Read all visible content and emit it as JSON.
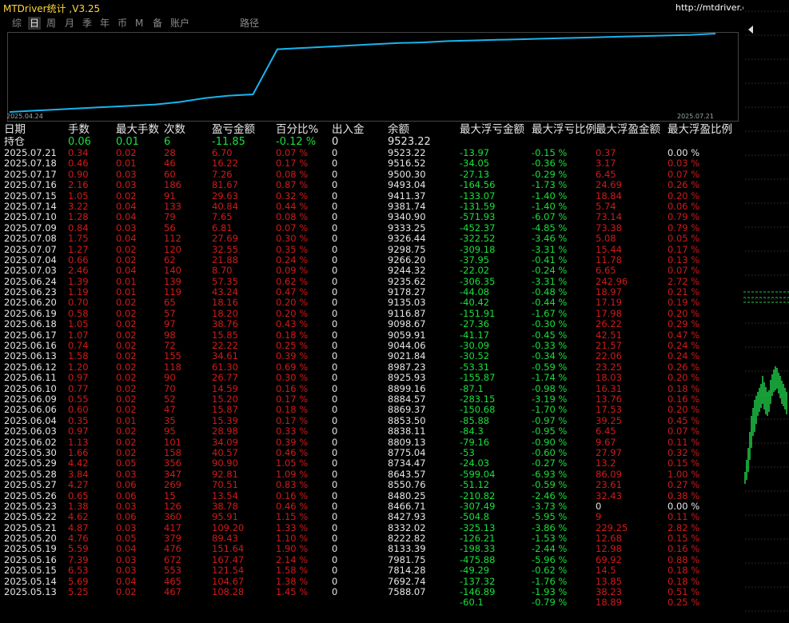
{
  "app": {
    "title": "MTDriver统计 ,V3.25",
    "url": "http://mtdriver.cn"
  },
  "tabs": [
    {
      "label": "综",
      "active": false
    },
    {
      "label": "日",
      "active": true
    },
    {
      "label": "周",
      "active": false
    },
    {
      "label": "月",
      "active": false
    },
    {
      "label": "季",
      "active": false
    },
    {
      "label": "年",
      "active": false
    },
    {
      "label": "币",
      "active": false
    },
    {
      "label": "M",
      "active": false
    },
    {
      "label": "备",
      "active": false
    },
    {
      "label": "账户",
      "active": false
    },
    {
      "label": "路径",
      "active": false
    }
  ],
  "colors": {
    "line": "#19b4ee",
    "positive": "#19e03a",
    "negative": "#d11a1a",
    "border": "#444444"
  },
  "chart_data": {
    "type": "line",
    "x_start_label": "2025.04.24",
    "x_end_label": "2025.07.21",
    "series": [
      {
        "values": [
          0.0,
          0.02,
          0.04,
          0.06,
          0.08,
          0.1,
          0.12,
          0.16,
          0.22,
          0.26,
          0.28,
          1.0,
          1.02,
          1.04,
          1.06,
          1.08,
          1.1,
          1.11,
          1.13,
          1.14,
          1.15,
          1.16,
          1.17,
          1.18,
          1.19,
          1.2,
          1.21,
          1.22,
          1.23,
          1.25
        ]
      }
    ]
  },
  "table": {
    "headers": [
      "日期",
      "手数",
      "最大手数",
      "次数",
      "盈亏金额",
      "百分比%",
      "出入金",
      "余额",
      "最大浮亏金额",
      "最大浮亏比例",
      "最大浮盈金额",
      "最大浮盈比例"
    ],
    "holding": {
      "date": "持仓",
      "lots": "0.06",
      "max_lots": "0.01",
      "count": "6",
      "pnl": "-11.85",
      "pct": "-0.12 %",
      "io": "0",
      "balance": "9523.22",
      "mfl_amt": "",
      "mfl_pct": "",
      "mfp_amt": "",
      "mfp_pct": ""
    },
    "rows": [
      {
        "date": "2025.07.21",
        "lots": "0.34",
        "max_lots": "0.02",
        "count": "28",
        "pnl": "6.70",
        "pct": "0.07 %",
        "io": "0",
        "balance": "9523.22",
        "mfl_amt": "-13.97",
        "mfl_pct": "-0.15 %",
        "mfp_amt": "0.37",
        "mfp_pct": "0.00 %"
      },
      {
        "date": "2025.07.18",
        "lots": "0.46",
        "max_lots": "0.01",
        "count": "46",
        "pnl": "16.22",
        "pct": "0.17 %",
        "io": "0",
        "balance": "9516.52",
        "mfl_amt": "-34.05",
        "mfl_pct": "-0.36 %",
        "mfp_amt": "3.17",
        "mfp_pct": "0.03 %"
      },
      {
        "date": "2025.07.17",
        "lots": "0.90",
        "max_lots": "0.03",
        "count": "60",
        "pnl": "7.26",
        "pct": "0.08 %",
        "io": "0",
        "balance": "9500.30",
        "mfl_amt": "-27.13",
        "mfl_pct": "-0.29 %",
        "mfp_amt": "6.45",
        "mfp_pct": "0.07 %"
      },
      {
        "date": "2025.07.16",
        "lots": "2.16",
        "max_lots": "0.03",
        "count": "186",
        "pnl": "81.67",
        "pct": "0.87 %",
        "io": "0",
        "balance": "9493.04",
        "mfl_amt": "-164.56",
        "mfl_pct": "-1.73 %",
        "mfp_amt": "24.69",
        "mfp_pct": "0.26 %"
      },
      {
        "date": "2025.07.15",
        "lots": "1.05",
        "max_lots": "0.02",
        "count": "91",
        "pnl": "29.63",
        "pct": "0.32 %",
        "io": "0",
        "balance": "9411.37",
        "mfl_amt": "-133.07",
        "mfl_pct": "-1.40 %",
        "mfp_amt": "18.84",
        "mfp_pct": "0.20 %"
      },
      {
        "date": "2025.07.14",
        "lots": "3.22",
        "max_lots": "0.04",
        "count": "133",
        "pnl": "40.84",
        "pct": "0.44 %",
        "io": "0",
        "balance": "9381.74",
        "mfl_amt": "-131.59",
        "mfl_pct": "-1.40 %",
        "mfp_amt": "5.74",
        "mfp_pct": "0.06 %"
      },
      {
        "date": "2025.07.10",
        "lots": "1.28",
        "max_lots": "0.04",
        "count": "79",
        "pnl": "7.65",
        "pct": "0.08 %",
        "io": "0",
        "balance": "9340.90",
        "mfl_amt": "-571.93",
        "mfl_pct": "-6.07 %",
        "mfp_amt": "73.14",
        "mfp_pct": "0.79 %"
      },
      {
        "date": "2025.07.09",
        "lots": "0.84",
        "max_lots": "0.03",
        "count": "56",
        "pnl": "6.81",
        "pct": "0.07 %",
        "io": "0",
        "balance": "9333.25",
        "mfl_amt": "-452.37",
        "mfl_pct": "-4.85 %",
        "mfp_amt": "73.38",
        "mfp_pct": "0.79 %"
      },
      {
        "date": "2025.07.08",
        "lots": "1.75",
        "max_lots": "0.04",
        "count": "112",
        "pnl": "27.69",
        "pct": "0.30 %",
        "io": "0",
        "balance": "9326.44",
        "mfl_amt": "-322.52",
        "mfl_pct": "-3.46 %",
        "mfp_amt": "5.08",
        "mfp_pct": "0.05 %"
      },
      {
        "date": "2025.07.07",
        "lots": "1.27",
        "max_lots": "0.02",
        "count": "120",
        "pnl": "32.55",
        "pct": "0.35 %",
        "io": "0",
        "balance": "9298.75",
        "mfl_amt": "-309.18",
        "mfl_pct": "-3.31 %",
        "mfp_amt": "15.44",
        "mfp_pct": "0.17 %"
      },
      {
        "date": "2025.07.04",
        "lots": "0.66",
        "max_lots": "0.02",
        "count": "62",
        "pnl": "21.88",
        "pct": "0.24 %",
        "io": "0",
        "balance": "9266.20",
        "mfl_amt": "-37.95",
        "mfl_pct": "-0.41 %",
        "mfp_amt": "11.78",
        "mfp_pct": "0.13 %"
      },
      {
        "date": "2025.07.03",
        "lots": "2.46",
        "max_lots": "0.04",
        "count": "140",
        "pnl": "8.70",
        "pct": "0.09 %",
        "io": "0",
        "balance": "9244.32",
        "mfl_amt": "-22.02",
        "mfl_pct": "-0.24 %",
        "mfp_amt": "6.65",
        "mfp_pct": "0.07 %"
      },
      {
        "date": "2025.06.24",
        "lots": "1.39",
        "max_lots": "0.01",
        "count": "139",
        "pnl": "57.35",
        "pct": "0.62 %",
        "io": "0",
        "balance": "9235.62",
        "mfl_amt": "-306.35",
        "mfl_pct": "-3.31 %",
        "mfp_amt": "242.96",
        "mfp_pct": "2.72 %"
      },
      {
        "date": "2025.06.23",
        "lots": "1.19",
        "max_lots": "0.01",
        "count": "119",
        "pnl": "43.24",
        "pct": "0.47 %",
        "io": "0",
        "balance": "9178.27",
        "mfl_amt": "-44.08",
        "mfl_pct": "-0.48 %",
        "mfp_amt": "18.97",
        "mfp_pct": "0.21 %"
      },
      {
        "date": "2025.06.20",
        "lots": "0.70",
        "max_lots": "0.02",
        "count": "65",
        "pnl": "18.16",
        "pct": "0.20 %",
        "io": "0",
        "balance": "9135.03",
        "mfl_amt": "-40.42",
        "mfl_pct": "-0.44 %",
        "mfp_amt": "17.19",
        "mfp_pct": "0.19 %"
      },
      {
        "date": "2025.06.19",
        "lots": "0.58",
        "max_lots": "0.02",
        "count": "57",
        "pnl": "18.20",
        "pct": "0.20 %",
        "io": "0",
        "balance": "9116.87",
        "mfl_amt": "-151.91",
        "mfl_pct": "-1.67 %",
        "mfp_amt": "17.98",
        "mfp_pct": "0.20 %"
      },
      {
        "date": "2025.06.18",
        "lots": "1.05",
        "max_lots": "0.02",
        "count": "97",
        "pnl": "38.76",
        "pct": "0.43 %",
        "io": "0",
        "balance": "9098.67",
        "mfl_amt": "-27.36",
        "mfl_pct": "-0.30 %",
        "mfp_amt": "26.22",
        "mfp_pct": "0.29 %"
      },
      {
        "date": "2025.06.17",
        "lots": "1.07",
        "max_lots": "0.02",
        "count": "98",
        "pnl": "15.85",
        "pct": "0.18 %",
        "io": "0",
        "balance": "9059.91",
        "mfl_amt": "-41.17",
        "mfl_pct": "-0.45 %",
        "mfp_amt": "42.51",
        "mfp_pct": "0.47 %"
      },
      {
        "date": "2025.06.16",
        "lots": "0.74",
        "max_lots": "0.02",
        "count": "72",
        "pnl": "22.22",
        "pct": "0.25 %",
        "io": "0",
        "balance": "9044.06",
        "mfl_amt": "-30.09",
        "mfl_pct": "-0.33 %",
        "mfp_amt": "21.57",
        "mfp_pct": "0.24 %"
      },
      {
        "date": "2025.06.13",
        "lots": "1.58",
        "max_lots": "0.02",
        "count": "155",
        "pnl": "34.61",
        "pct": "0.39 %",
        "io": "0",
        "balance": "9021.84",
        "mfl_amt": "-30.52",
        "mfl_pct": "-0.34 %",
        "mfp_amt": "22.06",
        "mfp_pct": "0.24 %"
      },
      {
        "date": "2025.06.12",
        "lots": "1.20",
        "max_lots": "0.02",
        "count": "118",
        "pnl": "61.30",
        "pct": "0.69 %",
        "io": "0",
        "balance": "8987.23",
        "mfl_amt": "-53.31",
        "mfl_pct": "-0.59 %",
        "mfp_amt": "23.25",
        "mfp_pct": "0.26 %"
      },
      {
        "date": "2025.06.11",
        "lots": "0.97",
        "max_lots": "0.02",
        "count": "90",
        "pnl": "26.77",
        "pct": "0.30 %",
        "io": "0",
        "balance": "8925.93",
        "mfl_amt": "-155.87",
        "mfl_pct": "-1.74 %",
        "mfp_amt": "18.03",
        "mfp_pct": "0.20 %"
      },
      {
        "date": "2025.06.10",
        "lots": "0.77",
        "max_lots": "0.02",
        "count": "70",
        "pnl": "14.59",
        "pct": "0.16 %",
        "io": "0",
        "balance": "8899.16",
        "mfl_amt": "-87.1",
        "mfl_pct": "-0.98 %",
        "mfp_amt": "16.31",
        "mfp_pct": "0.18 %"
      },
      {
        "date": "2025.06.09",
        "lots": "0.55",
        "max_lots": "0.02",
        "count": "52",
        "pnl": "15.20",
        "pct": "0.17 %",
        "io": "0",
        "balance": "8884.57",
        "mfl_amt": "-283.15",
        "mfl_pct": "-3.19 %",
        "mfp_amt": "13.76",
        "mfp_pct": "0.16 %"
      },
      {
        "date": "2025.06.06",
        "lots": "0.60",
        "max_lots": "0.02",
        "count": "47",
        "pnl": "15.87",
        "pct": "0.18 %",
        "io": "0",
        "balance": "8869.37",
        "mfl_amt": "-150.68",
        "mfl_pct": "-1.70 %",
        "mfp_amt": "17.53",
        "mfp_pct": "0.20 %"
      },
      {
        "date": "2025.06.04",
        "lots": "0.35",
        "max_lots": "0.01",
        "count": "35",
        "pnl": "15.39",
        "pct": "0.17 %",
        "io": "0",
        "balance": "8853.50",
        "mfl_amt": "-85.88",
        "mfl_pct": "-0.97 %",
        "mfp_amt": "39.25",
        "mfp_pct": "0.45 %"
      },
      {
        "date": "2025.06.03",
        "lots": "0.97",
        "max_lots": "0.02",
        "count": "95",
        "pnl": "28.98",
        "pct": "0.33 %",
        "io": "0",
        "balance": "8838.11",
        "mfl_amt": "-84.3",
        "mfl_pct": "-0.95 %",
        "mfp_amt": "6.45",
        "mfp_pct": "0.07 %"
      },
      {
        "date": "2025.06.02",
        "lots": "1.13",
        "max_lots": "0.02",
        "count": "101",
        "pnl": "34.09",
        "pct": "0.39 %",
        "io": "0",
        "balance": "8809.13",
        "mfl_amt": "-79.16",
        "mfl_pct": "-0.90 %",
        "mfp_amt": "9.67",
        "mfp_pct": "0.11 %"
      },
      {
        "date": "2025.05.30",
        "lots": "1.66",
        "max_lots": "0.02",
        "count": "158",
        "pnl": "40.57",
        "pct": "0.46 %",
        "io": "0",
        "balance": "8775.04",
        "mfl_amt": "-53",
        "mfl_pct": "-0.60 %",
        "mfp_amt": "27.97",
        "mfp_pct": "0.32 %"
      },
      {
        "date": "2025.05.29",
        "lots": "4.42",
        "max_lots": "0.05",
        "count": "356",
        "pnl": "90.90",
        "pct": "1.05 %",
        "io": "0",
        "balance": "8734.47",
        "mfl_amt": "-24.03",
        "mfl_pct": "-0.27 %",
        "mfp_amt": "13.2",
        "mfp_pct": "0.15 %"
      },
      {
        "date": "2025.05.28",
        "lots": "3.84",
        "max_lots": "0.03",
        "count": "347",
        "pnl": "92.81",
        "pct": "1.09 %",
        "io": "0",
        "balance": "8643.57",
        "mfl_amt": "-599.04",
        "mfl_pct": "-6.93 %",
        "mfp_amt": "86.09",
        "mfp_pct": "1.00 %"
      },
      {
        "date": "2025.05.27",
        "lots": "4.27",
        "max_lots": "0.06",
        "count": "269",
        "pnl": "70.51",
        "pct": "0.83 %",
        "io": "0",
        "balance": "8550.76",
        "mfl_amt": "-51.12",
        "mfl_pct": "-0.59 %",
        "mfp_amt": "23.61",
        "mfp_pct": "0.27 %"
      },
      {
        "date": "2025.05.26",
        "lots": "0.65",
        "max_lots": "0.06",
        "count": "15",
        "pnl": "13.54",
        "pct": "0.16 %",
        "io": "0",
        "balance": "8480.25",
        "mfl_amt": "-210.82",
        "mfl_pct": "-2.46 %",
        "mfp_amt": "32.43",
        "mfp_pct": "0.38 %"
      },
      {
        "date": "2025.05.23",
        "lots": "1.38",
        "max_lots": "0.03",
        "count": "126",
        "pnl": "38.78",
        "pct": "0.46 %",
        "io": "0",
        "balance": "8466.71",
        "mfl_amt": "-307.49",
        "mfl_pct": "-3.73 %",
        "mfp_amt": "0",
        "mfp_pct": "0.00 %"
      },
      {
        "date": "2025.05.22",
        "lots": "4.62",
        "max_lots": "0.06",
        "count": "360",
        "pnl": "95.91",
        "pct": "1.15 %",
        "io": "0",
        "balance": "8427.93",
        "mfl_amt": "-504.8",
        "mfl_pct": "-5.95 %",
        "mfp_amt": "9",
        "mfp_pct": "0.11 %"
      },
      {
        "date": "2025.05.21",
        "lots": "4.87",
        "max_lots": "0.03",
        "count": "417",
        "pnl": "109.20",
        "pct": "1.33 %",
        "io": "0",
        "balance": "8332.02",
        "mfl_amt": "-325.13",
        "mfl_pct": "-3.86 %",
        "mfp_amt": "229.25",
        "mfp_pct": "2.82 %"
      },
      {
        "date": "2025.05.20",
        "lots": "4.76",
        "max_lots": "0.05",
        "count": "379",
        "pnl": "89.43",
        "pct": "1.10 %",
        "io": "0",
        "balance": "8222.82",
        "mfl_amt": "-126.21",
        "mfl_pct": "-1.53 %",
        "mfp_amt": "12.68",
        "mfp_pct": "0.15 %"
      },
      {
        "date": "2025.05.19",
        "lots": "5.59",
        "max_lots": "0.04",
        "count": "476",
        "pnl": "151.64",
        "pct": "1.90 %",
        "io": "0",
        "balance": "8133.39",
        "mfl_amt": "-198.33",
        "mfl_pct": "-2.44 %",
        "mfp_amt": "12.98",
        "mfp_pct": "0.16 %"
      },
      {
        "date": "2025.05.16",
        "lots": "7.39",
        "max_lots": "0.03",
        "count": "672",
        "pnl": "167.47",
        "pct": "2.14 %",
        "io": "0",
        "balance": "7981.75",
        "mfl_amt": "-475.88",
        "mfl_pct": "-5.96 %",
        "mfp_amt": "69.92",
        "mfp_pct": "0.88 %"
      },
      {
        "date": "2025.05.15",
        "lots": "6.53",
        "max_lots": "0.03",
        "count": "553",
        "pnl": "121.54",
        "pct": "1.58 %",
        "io": "0",
        "balance": "7814.28",
        "mfl_amt": "-49.29",
        "mfl_pct": "-0.62 %",
        "mfp_amt": "14.5",
        "mfp_pct": "0.18 %"
      },
      {
        "date": "2025.05.14",
        "lots": "5.69",
        "max_lots": "0.04",
        "count": "465",
        "pnl": "104.67",
        "pct": "1.38 %",
        "io": "0",
        "balance": "7692.74",
        "mfl_amt": "-137.32",
        "mfl_pct": "-1.76 %",
        "mfp_amt": "13.85",
        "mfp_pct": "0.18 %"
      },
      {
        "date": "2025.05.13",
        "lots": "5.25",
        "max_lots": "0.02",
        "count": "467",
        "pnl": "108.28",
        "pct": "1.45 %",
        "io": "0",
        "balance": "7588.07",
        "mfl_amt": "-146.89",
        "mfl_pct": "-1.93 %",
        "mfp_amt": "38.23",
        "mfp_pct": "0.51 %"
      },
      {
        "date": "",
        "lots": "",
        "max_lots": "",
        "count": "",
        "pnl": "",
        "pct": "",
        "io": "",
        "balance": "",
        "mfl_amt": "-60.1",
        "mfl_pct": "-0.79 %",
        "mfp_amt": "18.89",
        "mfp_pct": "0.25 %"
      }
    ]
  }
}
